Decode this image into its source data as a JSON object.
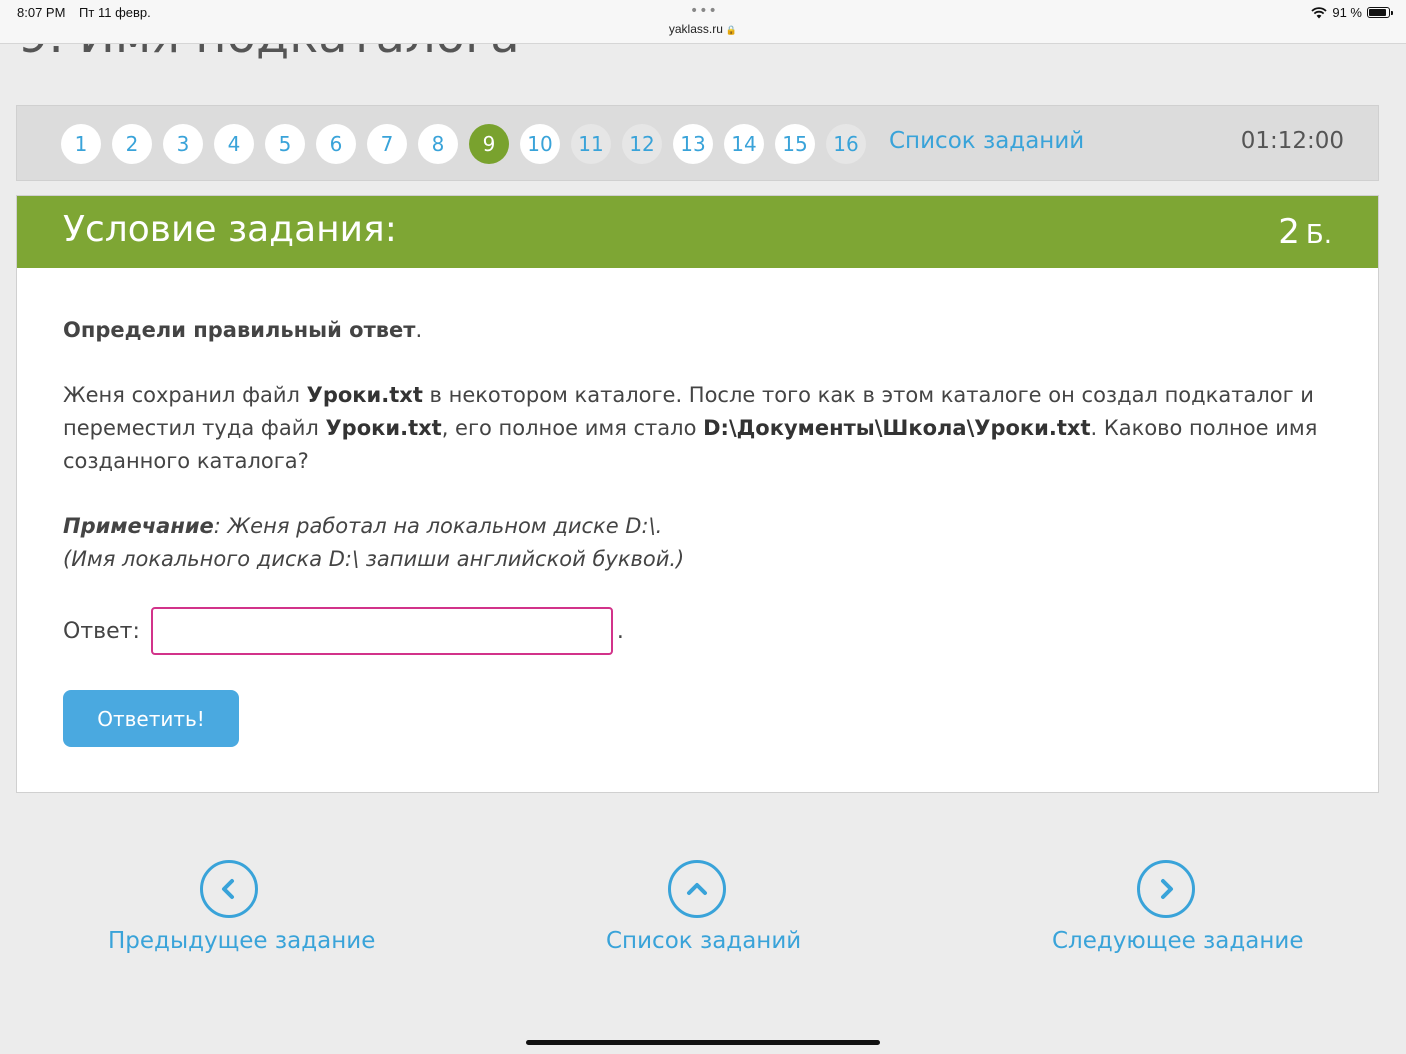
{
  "status_bar": {
    "time": "8:07 PM",
    "date": "Пт 11 февр.",
    "url": "yaklass.ru",
    "battery_text": "91 %",
    "battery_level": 0.91
  },
  "page": {
    "title_partial": "9. Имя подкаталога"
  },
  "task_nav": {
    "numbers": [
      "1",
      "2",
      "3",
      "4",
      "5",
      "6",
      "7",
      "8",
      "9",
      "10",
      "11",
      "12",
      "13",
      "14",
      "15",
      "16"
    ],
    "active": "9",
    "task_list_label": "Список заданий",
    "timer": "01:12:00"
  },
  "task": {
    "header": "Условие задания:",
    "points_value": "2",
    "points_unit": "Б.",
    "instruction": "Определи правильный ответ",
    "instruction_end": ".",
    "text": {
      "t1": "Женя сохранил файл ",
      "b1": "Уроки.txt",
      "t2": " в некотором каталоге. После того как в этом каталоге он создал подкаталог и переместил туда файл ",
      "b2": "Уроки.txt",
      "t3": ", его полное имя стало ",
      "b3": "D:\\Документы\\Школа\\Уроки.txt",
      "t4": ". Каково полное имя созданного каталога?"
    },
    "note_label": "Примечание",
    "note_text": ": Женя работал на локальном диске D:\\.",
    "note_line2": "(Имя локального диска D:\\ запиши английской буквой.)",
    "answer_label": "Ответ:",
    "answer_value": "",
    "answer_period": ".",
    "submit_label": "Ответить!"
  },
  "bottom_nav": {
    "prev_label": "Предыдущее задание",
    "list_label": "Список заданий",
    "next_label": "Следующее задание"
  },
  "colors": {
    "accent_blue": "#39a3d9",
    "header_green": "#7ea634",
    "active_pill": "#79a22e",
    "input_border": "#d2338a",
    "button_blue": "#4aa9e0"
  }
}
